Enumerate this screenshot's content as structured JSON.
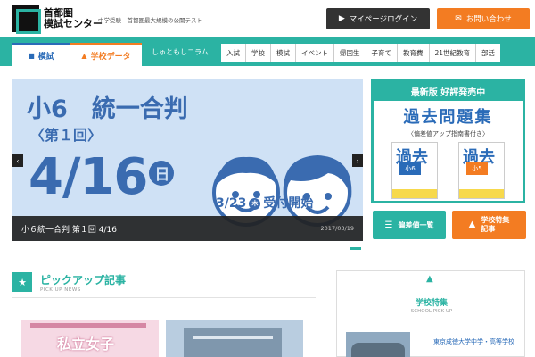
{
  "header": {
    "logo_line1": "首都圏",
    "logo_line2": "模試センター",
    "tagline": "中学受験　首都圏最大規模の公開テスト",
    "mypage_label": "マイページログイン",
    "contact_label": "お問い合わせ"
  },
  "nav": {
    "tabs": [
      {
        "label": "模試"
      },
      {
        "label": "学校データ"
      }
    ],
    "column_label": "しゅともしコラム",
    "categories": [
      "入試",
      "学校",
      "模試",
      "イベント",
      "帰国生",
      "子育て",
      "教育費",
      "21世紀教育",
      "部活"
    ]
  },
  "slider": {
    "title_line1": "小6　統一合判",
    "title_line2": "〈第１回〉",
    "date_big": "4/16",
    "day_char": "日",
    "reception_date": "3/23",
    "reception_day": "木",
    "reception_text": "受付開始",
    "caption_title": "小６統一合判 第１回 4/16",
    "caption_date": "2017/03/19"
  },
  "book_ad": {
    "headline": "最新版 好評発売中",
    "title": "過去問題集",
    "subtitle": "〈偏差値アップ指南書付き〉",
    "book_cover": "過去",
    "book1_grade": "小6",
    "book2_grade": "小5"
  },
  "side_buttons": {
    "hensachi_label": "偏差値一覧",
    "feature_label_line1": "学校特集",
    "feature_label_line2": "記事"
  },
  "pickup": {
    "title": "ピックアップ記事",
    "subtitle": "PICK UP NEWS",
    "thumb1_text": "私立女子"
  },
  "school_pickup": {
    "title": "学校特集",
    "subtitle": "SCHOOL PICK UP",
    "school_name": "東京成徳大学中学・高等学校"
  },
  "colors": {
    "teal": "#2bb3a3",
    "orange": "#f37c22",
    "blue": "#2a6bb8",
    "dark": "#333333"
  }
}
